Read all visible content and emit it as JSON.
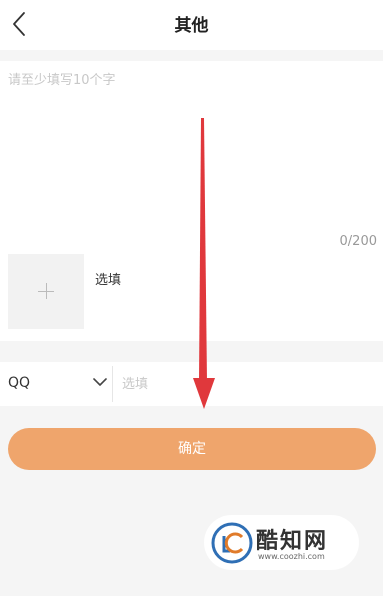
{
  "header": {
    "title": "其他",
    "back_icon": "chevron-left-icon"
  },
  "feedback": {
    "placeholder": "请至少填写10个字",
    "char_count": "0/200"
  },
  "upload": {
    "icon": "plus-icon",
    "hint": "选填"
  },
  "contact": {
    "type": "QQ",
    "dropdown_icon": "chevron-down-icon",
    "placeholder": "选填"
  },
  "confirm_button": {
    "label": "确定",
    "color": "#efa56c"
  },
  "annotation": {
    "arrow_color": "#e0383c"
  },
  "watermark": {
    "name": "酷知网",
    "url": "www.coozhi.com"
  }
}
